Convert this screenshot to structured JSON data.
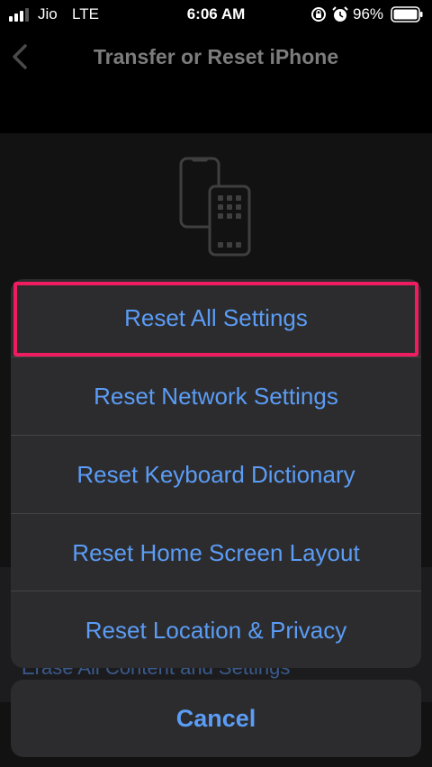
{
  "status_bar": {
    "carrier": "Jio",
    "network": "LTE",
    "time": "6:06 AM",
    "battery_percent": "96%",
    "icons": [
      "signal-icon",
      "rotation-lock-icon",
      "alarm-icon",
      "battery-icon"
    ]
  },
  "nav": {
    "back_icon": "chevron-left-icon",
    "title": "Transfer or Reset iPhone"
  },
  "page": {
    "hero_icon": "two-phones-icon",
    "partial_row_text": "Erase All Content and Settings"
  },
  "action_sheet": {
    "items": [
      "Reset All Settings",
      "Reset Network Settings",
      "Reset Keyboard Dictionary",
      "Reset Home Screen Layout",
      "Reset Location & Privacy"
    ],
    "highlighted_item": "Reset All Settings",
    "cancel_label": "Cancel"
  },
  "colors": {
    "action_text": "#5b9cf5",
    "highlight_border": "#ef1d5f",
    "sheet_background": "#2c2c2e",
    "page_background": "#121212"
  }
}
